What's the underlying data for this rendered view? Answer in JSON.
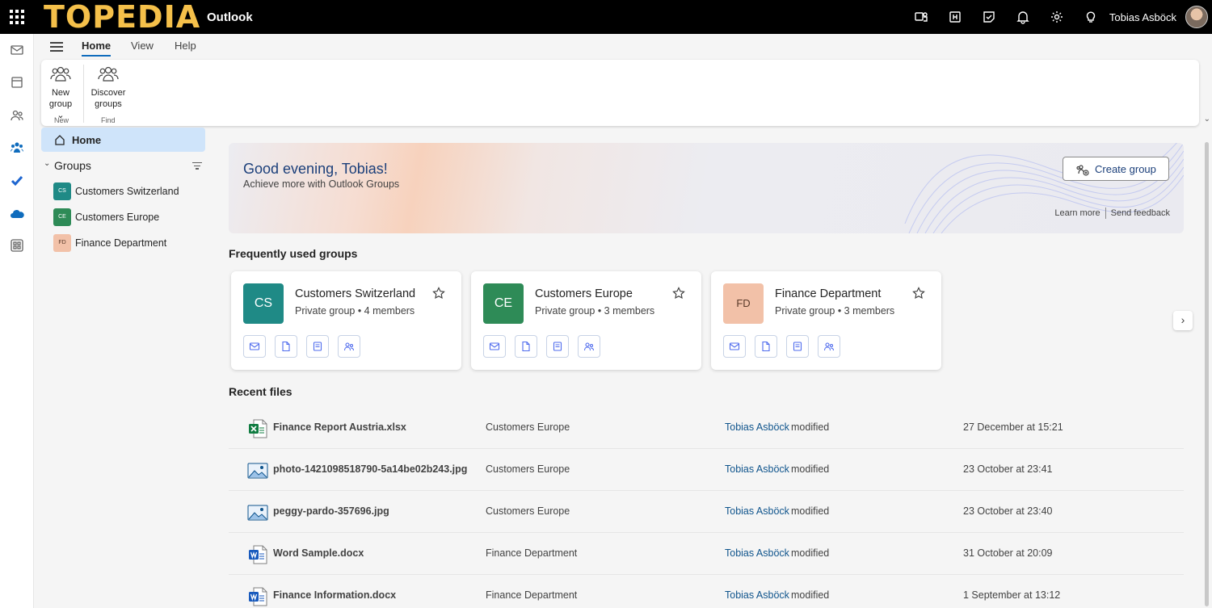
{
  "topbar": {
    "brand": "TOPEDIA",
    "app_title": "Outlook",
    "user_name": "Tobias Asböck",
    "icons": [
      "waffle-icon",
      "teams-icon",
      "office-icon",
      "notes-icon",
      "bell-icon",
      "gear-icon",
      "lightbulb-icon"
    ]
  },
  "rail": {
    "icons": [
      "mail-icon",
      "calendar-icon",
      "people-icon",
      "groups-icon",
      "todo-icon",
      "onedrive-icon",
      "apps-icon"
    ]
  },
  "ribbon": {
    "tabs": [
      "Home",
      "View",
      "Help"
    ],
    "active_tab": "Home",
    "buttons": [
      {
        "label_line1": "New",
        "label_line2": "group ⌄",
        "group": "New"
      },
      {
        "label_line1": "Discover",
        "label_line2": "groups",
        "group": "Find"
      }
    ]
  },
  "left_pane": {
    "home_label": "Home",
    "groups_label": "Groups",
    "groups": [
      {
        "abbr": "CS",
        "name": "Customers Switzerland",
        "color": "#1f8a86"
      },
      {
        "abbr": "CE",
        "name": "Customers Europe",
        "color": "#2e8b57"
      },
      {
        "abbr": "FD",
        "name": "Finance Department",
        "color": "#f2c1a8"
      }
    ]
  },
  "hero": {
    "title": "Good evening, Tobias!",
    "subtitle": "Achieve more with Outlook Groups",
    "create_button": "Create group",
    "learn_more": "Learn more",
    "send_feedback": "Send feedback"
  },
  "frequent": {
    "title": "Frequently used groups",
    "cards": [
      {
        "abbr": "CS",
        "name": "Customers Switzerland",
        "meta": "Private group • 4 members",
        "color": "#1f8a86",
        "text_color": "#ffffff"
      },
      {
        "abbr": "CE",
        "name": "Customers Europe",
        "meta": "Private group • 3 members",
        "color": "#2e8b57",
        "text_color": "#ffffff"
      },
      {
        "abbr": "FD",
        "name": "Finance Department",
        "meta": "Private group • 3 members",
        "color": "#f2c1a8",
        "text_color": "#5a3a2a"
      }
    ],
    "card_actions": [
      "mail-icon",
      "file-icon",
      "notebook-icon",
      "members-icon"
    ]
  },
  "recent": {
    "title": "Recent files",
    "files": [
      {
        "icon": "excel-icon",
        "name": "Finance Report Austria.xlsx",
        "group": "Customers Europe",
        "user": "Tobias Asböck",
        "action": "modified",
        "date": "27 December at 15:21"
      },
      {
        "icon": "image-icon",
        "name": "photo-1421098518790-5a14be02b243.jpg",
        "group": "Customers Europe",
        "user": "Tobias Asböck",
        "action": "modified",
        "date": "23 October at 23:41"
      },
      {
        "icon": "image-icon",
        "name": "peggy-pardo-357696.jpg",
        "group": "Customers Europe",
        "user": "Tobias Asböck",
        "action": "modified",
        "date": "23 October at 23:40"
      },
      {
        "icon": "word-icon",
        "name": "Word Sample.docx",
        "group": "Finance Department",
        "user": "Tobias Asböck",
        "action": "modified",
        "date": "31 October at 20:09"
      },
      {
        "icon": "word-icon",
        "name": "Finance Information.docx",
        "group": "Finance Department",
        "user": "Tobias Asböck",
        "action": "modified",
        "date": "1 September at 13:12"
      }
    ]
  },
  "colors": {
    "accent": "#0f6cbd",
    "topbar": "#000000",
    "brand": "#f5c04a",
    "selected_nav": "#cfe4fa"
  }
}
